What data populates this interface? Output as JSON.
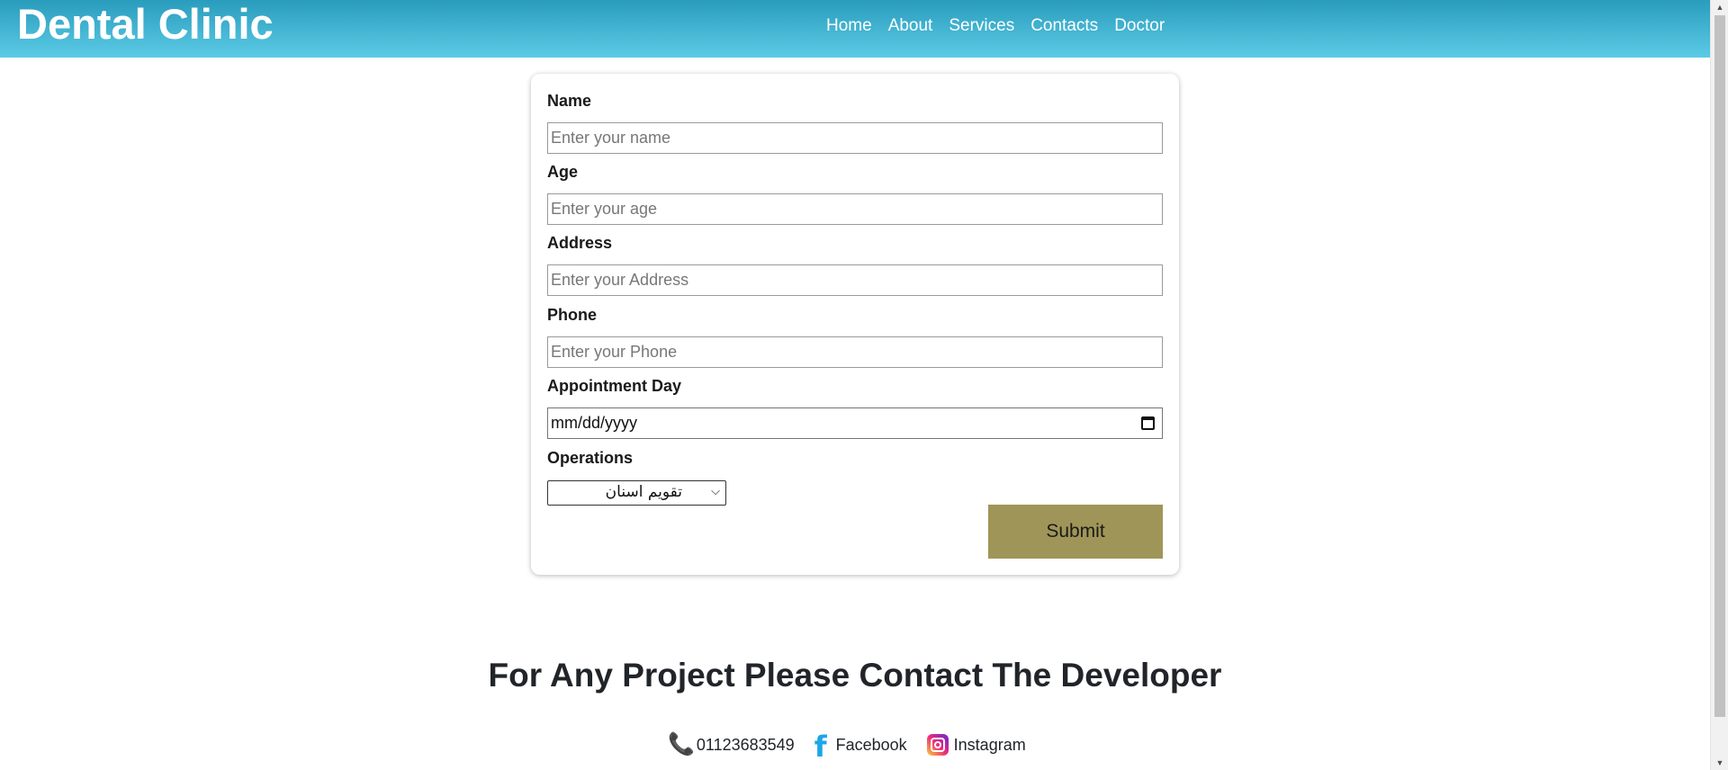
{
  "header": {
    "brand": "Dental Clinic",
    "nav": [
      "Home",
      "About",
      "Services",
      "Contacts",
      "Doctor"
    ]
  },
  "form": {
    "fields": [
      {
        "label": "Name",
        "placeholder": "Enter your name"
      },
      {
        "label": "Age",
        "placeholder": "Enter your age"
      },
      {
        "label": "Address",
        "placeholder": "Enter your Address"
      },
      {
        "label": "Phone",
        "placeholder": "Enter your Phone"
      }
    ],
    "appointment": {
      "label": "Appointment Day",
      "value": "mm/dd/yyyy"
    },
    "operations": {
      "label": "Operations",
      "selected": "تقويم اسنان"
    },
    "submit_label": "Submit"
  },
  "footer": {
    "title": "For Any Project Please Contact The Developer",
    "phone": "01123683549",
    "facebook": "Facebook",
    "instagram": "Instagram"
  },
  "colors": {
    "header_gradient_top": "#2a9cbc",
    "header_gradient_bottom": "#5bcbe6",
    "submit_bg": "#a09558",
    "facebook_blue": "#1ea6e6"
  },
  "icons": {
    "phone": "phone-icon",
    "facebook": "facebook-icon",
    "instagram": "instagram-icon",
    "calendar": "calendar-icon",
    "select": "chevron-down-icon"
  }
}
